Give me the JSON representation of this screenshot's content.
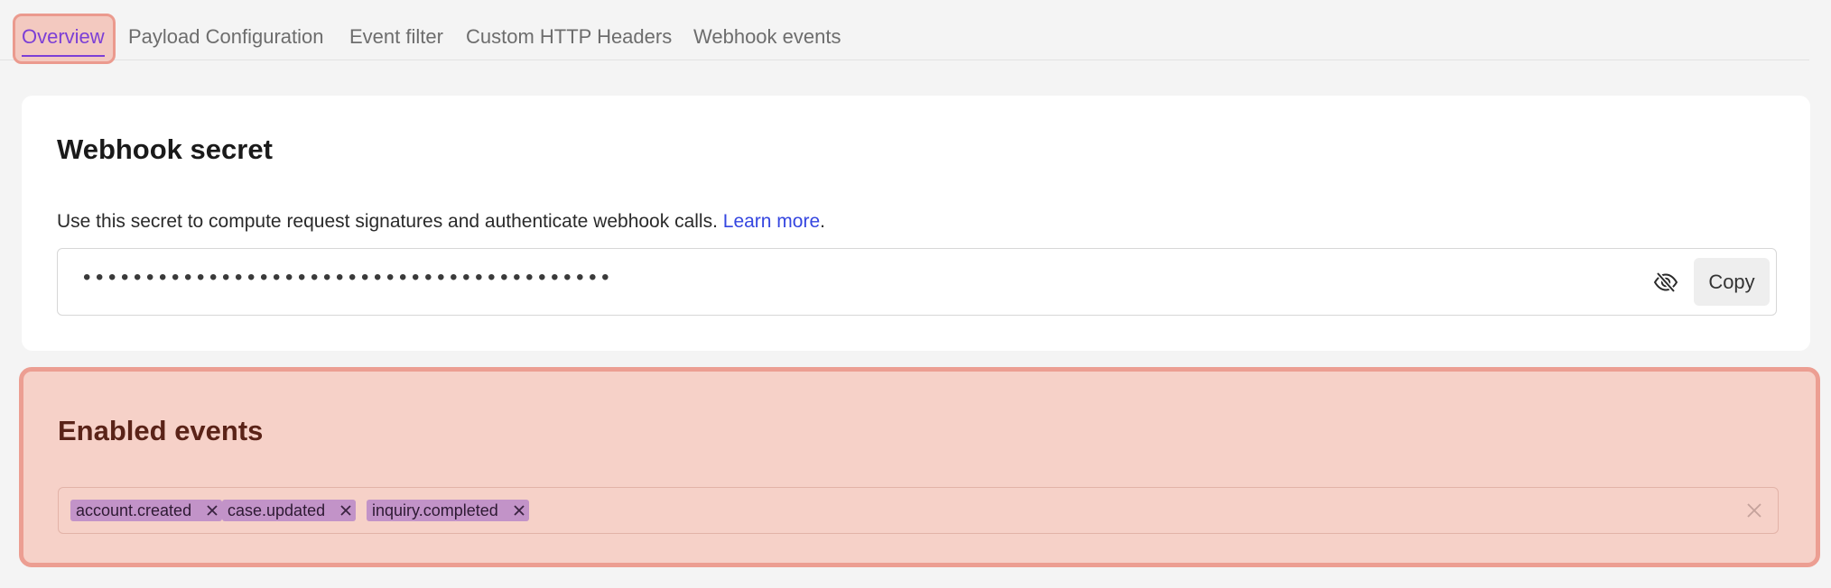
{
  "tabs": [
    {
      "label": "Overview",
      "active": true
    },
    {
      "label": "Payload Configuration",
      "active": false
    },
    {
      "label": "Event filter",
      "active": false
    },
    {
      "label": "Custom HTTP Headers",
      "active": false
    },
    {
      "label": "Webhook events",
      "active": false
    }
  ],
  "secret": {
    "title": "Webhook secret",
    "description": "Use this secret to compute request signatures and authenticate webhook calls.",
    "learn_more": "Learn more",
    "description_end": ".",
    "masked_value": "••••••••••••••••••••••••••••••••••••••••••",
    "visibility_icon": "eye-off-icon",
    "copy_label": "Copy"
  },
  "events": {
    "title": "Enabled events",
    "tags": [
      "account.created",
      "case.updated",
      "inquiry.completed"
    ],
    "tag_remove_icon": "close-icon",
    "clear_icon": "close-icon"
  },
  "colors": {
    "accent": "#7c3fd6",
    "link": "#3546e0",
    "tag_bg": "#c293c8",
    "highlight_fill": "#f6d1c8",
    "highlight_border": "#ec9e92"
  }
}
